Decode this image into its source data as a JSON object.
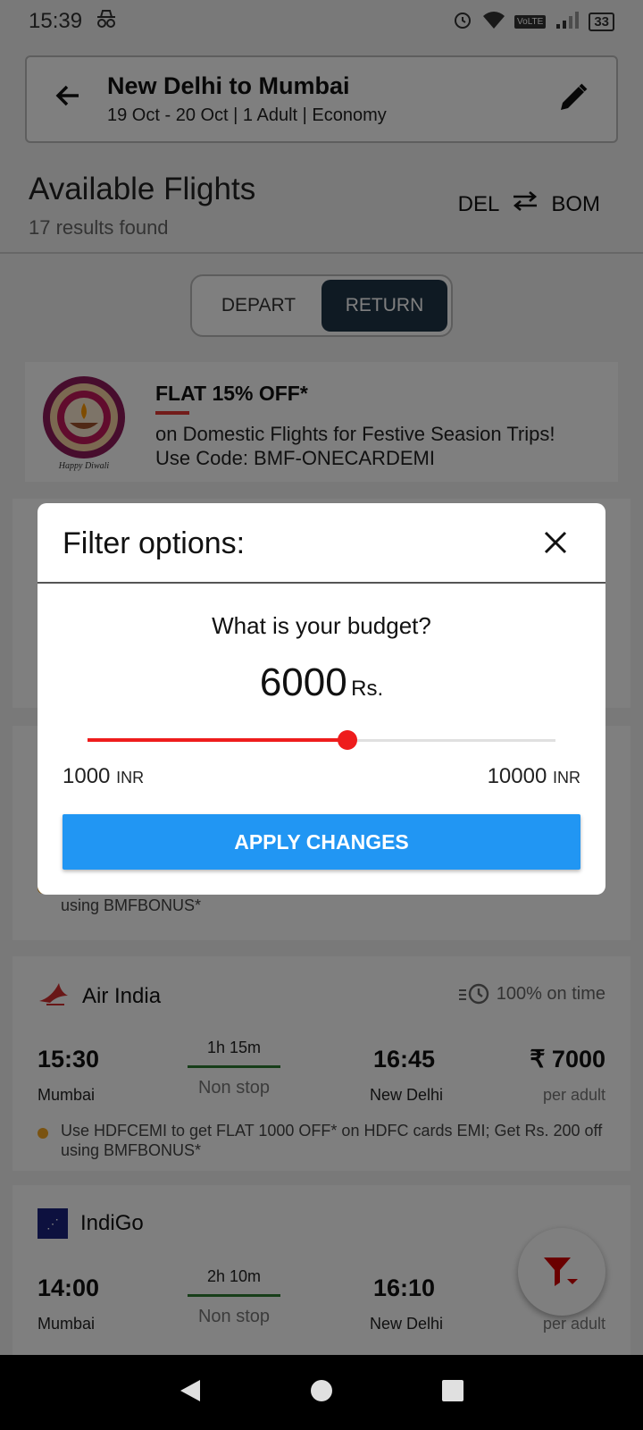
{
  "status_bar": {
    "time": "15:39",
    "battery": "33",
    "network": "VoLTE"
  },
  "header": {
    "title": "New Delhi to Mumbai",
    "subtitle": "19 Oct - 20 Oct | 1 Adult | Economy"
  },
  "results": {
    "title": "Available Flights",
    "count": "17 results found",
    "from": "DEL",
    "to": "BOM"
  },
  "toggle": {
    "depart": "DEPART",
    "return": "RETURN",
    "active": "RETURN"
  },
  "promo": {
    "headline": "FLAT 15% OFF*",
    "line1": "on Domestic Flights for Festive Seasion Trips!",
    "line2": "Use Code: BMF-ONECARDEMI",
    "logo_caption": "Happy Diwali"
  },
  "offer_note": "Use HDFCEMI to get FLAT 1000 OFF* on HDFC cards EMI; Get Rs. 200 off using  BMFBONUS*",
  "flights": [
    {
      "airline": "Air India",
      "on_time": "100% on time",
      "dep_time": "15:30",
      "dep_city": "Mumbai",
      "duration": "1h 15m",
      "stops": "Non stop",
      "arr_time": "16:45",
      "arr_city": "New Delhi",
      "price": "₹ 7000",
      "per": "per adult"
    },
    {
      "airline": "IndiGo",
      "dep_time": "14:00",
      "dep_city": "Mumbai",
      "duration": "2h 10m",
      "stops": "Non stop",
      "arr_time": "16:10",
      "arr_city": "New Delhi",
      "per": "per adult"
    }
  ],
  "filter_dialog": {
    "title": "Filter options:",
    "question": "What is your budget?",
    "amount": "6000",
    "amount_unit": "Rs.",
    "min_value": "1000",
    "max_value": "10000",
    "range_unit": "INR",
    "slider_fraction": 0.5556,
    "apply_label": "APPLY CHANGES"
  },
  "colors": {
    "accent": "#2196f3",
    "slider": "#ee1c1c",
    "toggle_active": "#1f3447",
    "duration_line": "#2e7d32"
  }
}
